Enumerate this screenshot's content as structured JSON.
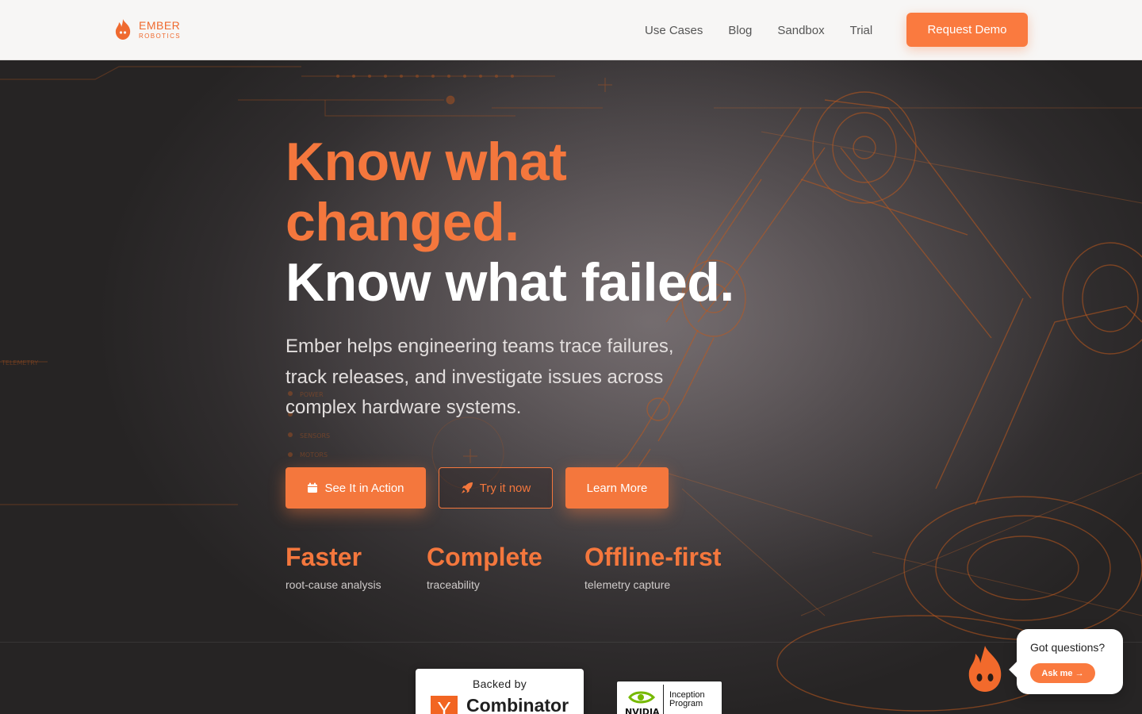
{
  "brand": {
    "name": "EMBER",
    "tagline": "ROBOTICS",
    "color": "#ef6a2f"
  },
  "nav": {
    "links": [
      "Use Cases",
      "Blog",
      "Sandbox",
      "Trial"
    ],
    "cta": "Request Demo"
  },
  "hero": {
    "headline_orange_1": "Know what",
    "headline_orange_2": "changed.",
    "headline_white": "Know what failed.",
    "subtitle": "Ember helps engineering teams trace failures, track releases, and investigate issues across complex hardware systems.",
    "buttons": [
      {
        "label": "See It in Action",
        "icon": "calendar-icon",
        "style": "primary"
      },
      {
        "label": "Try it now",
        "icon": "rocket-icon",
        "style": "outline"
      },
      {
        "label": "Learn More",
        "icon": "",
        "style": "primary"
      }
    ],
    "stats": [
      {
        "title": "Faster",
        "subtitle": "root-cause analysis"
      },
      {
        "title": "Complete",
        "subtitle": "traceability"
      },
      {
        "title": "Offline-first",
        "subtitle": "telemetry capture"
      }
    ],
    "background_labels": [
      "TELEMETRY",
      "POWER",
      "SENSORS",
      "MOTORS"
    ]
  },
  "backers": {
    "yc_prefix": "Backed by",
    "yc_logo_letter": "Y",
    "yc_name": "Combinator",
    "nvidia_brand": "NVIDIA",
    "nvidia_line1": "Inception",
    "nvidia_line2": "Program"
  },
  "chat": {
    "question": "Got questions?",
    "button": "Ask me →"
  },
  "colors": {
    "accent": "#f4773d",
    "accent_button": "#fa7a3f",
    "header_bg": "#f7f6f5",
    "hero_bg": "#2f2c2d"
  }
}
